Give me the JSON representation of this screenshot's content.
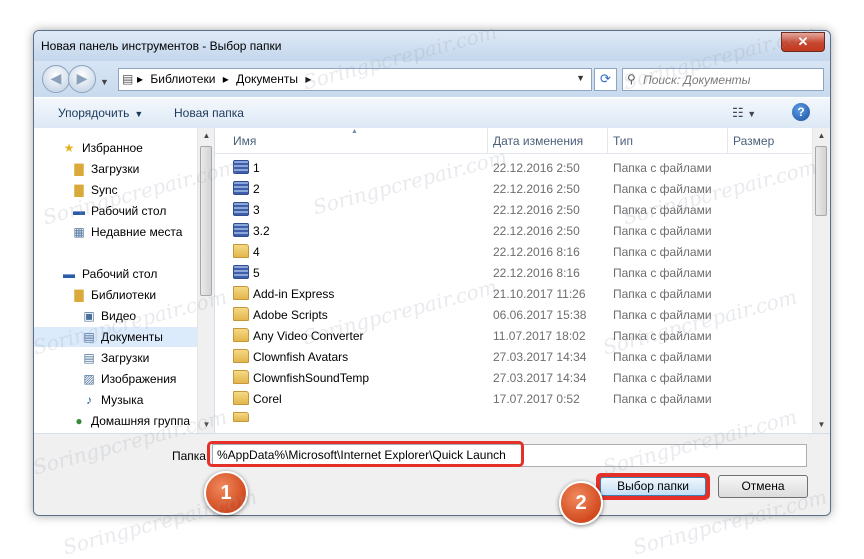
{
  "window": {
    "title": "Новая панель инструментов - Выбор папки",
    "close_label": "✕"
  },
  "address": {
    "crumbs": [
      "Библиотеки",
      "Документы"
    ],
    "search_placeholder": "Поиск: Документы"
  },
  "toolbar": {
    "organize_label": "Упорядочить",
    "new_folder_label": "Новая папка",
    "help_label": "?"
  },
  "nav": {
    "items": [
      {
        "label": "Избранное",
        "icon": "star-icon"
      },
      {
        "label": "Загрузки",
        "icon": "downloads-folder-icon"
      },
      {
        "label": "Sync",
        "icon": "sync-folder-icon"
      },
      {
        "label": "Рабочий стол",
        "icon": "desktop-icon"
      },
      {
        "label": "Недавние места",
        "icon": "recent-places-icon"
      },
      {
        "label": "Рабочий стол",
        "icon": "desktop-icon"
      },
      {
        "label": "Библиотеки",
        "icon": "libraries-icon"
      },
      {
        "label": "Видео",
        "icon": "video-library-icon"
      },
      {
        "label": "Документы",
        "icon": "documents-library-icon"
      },
      {
        "label": "Загрузки",
        "icon": "downloads-library-icon"
      },
      {
        "label": "Изображения",
        "icon": "pictures-library-icon"
      },
      {
        "label": "Музыка",
        "icon": "music-library-icon"
      },
      {
        "label": "Домашняя группа",
        "icon": "homegroup-icon"
      }
    ]
  },
  "files": {
    "headers": {
      "name": "Имя",
      "date": "Дата изменения",
      "type": "Тип",
      "size": "Размер"
    },
    "rows": [
      {
        "name": "1",
        "date": "22.12.2016 2:50",
        "type": "Папка с файлами",
        "icon": "library-folder-icon"
      },
      {
        "name": "2",
        "date": "22.12.2016 2:50",
        "type": "Папка с файлами",
        "icon": "library-folder-icon"
      },
      {
        "name": "3",
        "date": "22.12.2016 2:50",
        "type": "Папка с файлами",
        "icon": "library-folder-icon"
      },
      {
        "name": "3.2",
        "date": "22.12.2016 2:50",
        "type": "Папка с файлами",
        "icon": "library-folder-icon"
      },
      {
        "name": "4",
        "date": "22.12.2016 8:16",
        "type": "Папка с файлами",
        "icon": "folder-icon"
      },
      {
        "name": "5",
        "date": "22.12.2016 8:16",
        "type": "Папка с файлами",
        "icon": "library-folder-icon"
      },
      {
        "name": "Add-in Express",
        "date": "21.10.2017 11:26",
        "type": "Папка с файлами",
        "icon": "folder-icon"
      },
      {
        "name": "Adobe Scripts",
        "date": "06.06.2017 15:38",
        "type": "Папка с файлами",
        "icon": "folder-icon"
      },
      {
        "name": "Any Video Converter",
        "date": "11.07.2017 18:02",
        "type": "Папка с файлами",
        "icon": "folder-icon"
      },
      {
        "name": "Clownfish Avatars",
        "date": "27.03.2017 14:34",
        "type": "Папка с файлами",
        "icon": "folder-icon"
      },
      {
        "name": "ClownfishSoundTemp",
        "date": "27.03.2017 14:34",
        "type": "Папка с файлами",
        "icon": "folder-icon"
      },
      {
        "name": "Corel",
        "date": "17.07.2017 0:52",
        "type": "Папка с файлами",
        "icon": "folder-icon"
      }
    ]
  },
  "bottom": {
    "folder_label": "Папка:",
    "folder_value": "%AppData%\\Microsoft\\Internet Explorer\\Quick Launch",
    "select_label": "Выбор папки",
    "cancel_label": "Отмена"
  },
  "annotations": {
    "badge1": "1",
    "badge2": "2"
  },
  "watermark": "Soringpcrepair.com",
  "colors": {
    "highlight": "#e5302a",
    "badge": "#d24a1f",
    "selected_nav": "#dcebfc"
  }
}
